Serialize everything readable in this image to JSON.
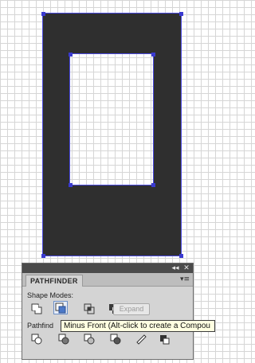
{
  "panel": {
    "topbar": {
      "collapse_icon": "double-chevron-left-icon",
      "close_icon": "close-icon",
      "collapse_glyph": "◂◂",
      "close_glyph": "✕"
    },
    "tab_label": "PATHFINDER",
    "menu_icon": "panel-menu-icon",
    "menu_glyph": "▾≡",
    "shape_modes": {
      "label": "Shape Modes:",
      "buttons": [
        {
          "name": "unite-icon",
          "active": false
        },
        {
          "name": "minus-front-icon",
          "active": true
        },
        {
          "name": "intersect-icon",
          "active": false
        },
        {
          "name": "exclude-icon",
          "active": false
        }
      ],
      "expand_label": "Expand"
    },
    "pathfinders": {
      "label": "Pathfinders:",
      "label_visible": "Pathfind",
      "icons": [
        "divide-icon",
        "trim-icon",
        "merge-icon",
        "crop-icon",
        "outline-icon",
        "minus-back-icon"
      ]
    }
  },
  "tooltip": {
    "text": "Minus Front (Alt-click to create a Compound Shape)",
    "visible_text": "Minus Front (Alt-click to create a Compou"
  },
  "colors": {
    "shape_fill": "#2f2f2f",
    "selection": "#3a3ad0",
    "panel_bg": "#d4d4d4",
    "tooltip_bg": "#ffffe1"
  }
}
